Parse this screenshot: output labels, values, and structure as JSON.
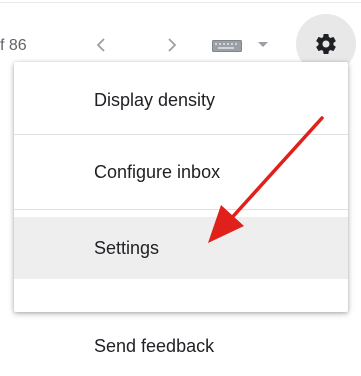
{
  "toolbar": {
    "page_count": "f 86",
    "prev_icon": "chevron-left-icon",
    "next_icon": "chevron-right-icon",
    "keyboard_icon": "keyboard-icon",
    "dropdown_icon": "caret-down-icon",
    "settings_icon": "gear-icon"
  },
  "menu": {
    "items": [
      {
        "label": "Display density"
      },
      {
        "label": "Configure inbox"
      },
      {
        "label": "Settings"
      },
      {
        "label": "Send feedback"
      }
    ]
  },
  "annotation": {
    "arrow_icon": "red-arrow-icon",
    "arrow_color": "#e0201b"
  },
  "colors": {
    "hover_background": "#eeeeee",
    "gear_button_background": "#e8e8e8",
    "icon_gray": "#5f6368"
  }
}
